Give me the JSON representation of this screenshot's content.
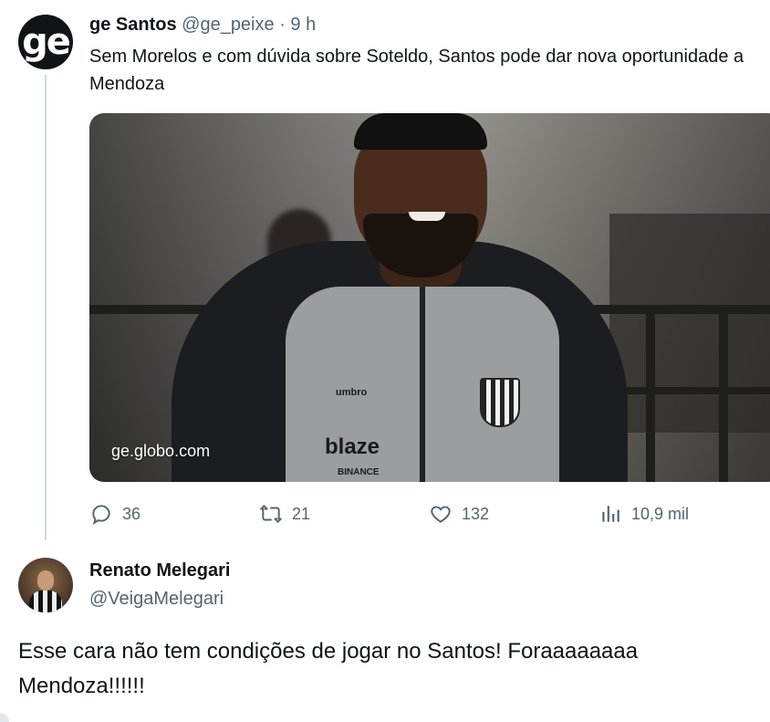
{
  "tweet": {
    "avatar_text": "ge",
    "author_name": "ge Santos",
    "handle": "@ge_peixe",
    "separator": "·",
    "time": "9 h",
    "text": "Sem Morelos e com dúvida sobre Soteldo, Santos pode dar nova oportunidade a Mendoza",
    "media": {
      "watermark": "ge.globo.com",
      "shirt_texts": {
        "umbro": "umbro",
        "blaze": "blaze",
        "binance": "BINANCE"
      }
    },
    "actions": {
      "replies": "36",
      "retweets": "21",
      "likes": "132",
      "views": "10,9 mil"
    }
  },
  "reply": {
    "author_name": "Renato Melegari",
    "handle": "@VeigaMelegari",
    "text": "Esse cara não tem condições de jogar no Santos! Foraaaaaaaa Mendoza!!!!!!"
  },
  "icons": {
    "reply": "reply-icon",
    "retweet": "retweet-icon",
    "like": "heart-icon",
    "views": "views-icon"
  },
  "colors": {
    "text": "#0f1419",
    "muted": "#536471",
    "thread_line": "#cfd9de"
  }
}
